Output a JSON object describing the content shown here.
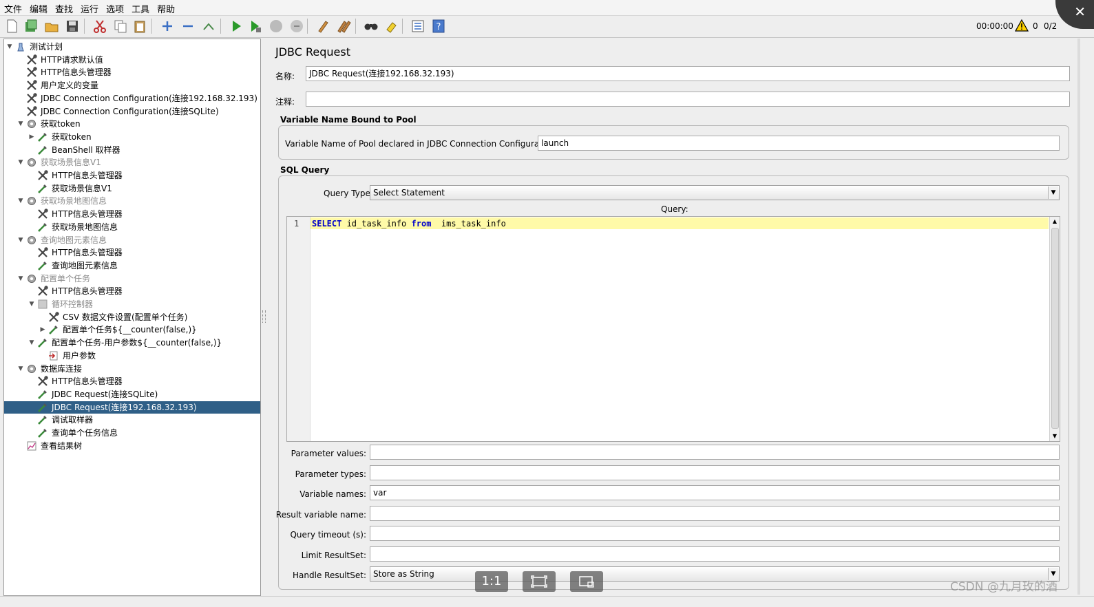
{
  "menu": [
    "文件",
    "编辑",
    "查找",
    "运行",
    "选项",
    "工具",
    "帮助"
  ],
  "toolbar": {
    "icons": [
      "new-icon",
      "templates-icon",
      "open-icon",
      "save-icon",
      "cut-icon",
      "copy-icon",
      "paste-icon",
      "expand-icon",
      "collapse-icon",
      "toggle-icon",
      "start-icon",
      "start-no-pause-icon",
      "stop-icon",
      "shutdown-icon",
      "clear-icon",
      "clear-all-icon",
      "search-icon",
      "reset-search-icon",
      "function-helper-icon",
      "help-icon"
    ],
    "timer": "00:00:00",
    "warning_count": "0",
    "threads": "0/2"
  },
  "tree": [
    {
      "label": "测试计划",
      "icon": "test-plan-icon",
      "toggle": "▼",
      "depth": 0,
      "disabled": false,
      "selected": false
    },
    {
      "label": "HTTP请求默认值",
      "icon": "config-wrench-icon",
      "toggle": "",
      "depth": 1,
      "disabled": false,
      "selected": false
    },
    {
      "label": "HTTP信息头管理器",
      "icon": "config-wrench-icon",
      "toggle": "",
      "depth": 1,
      "disabled": false,
      "selected": false
    },
    {
      "label": "用户定义的变量",
      "icon": "config-wrench-icon",
      "toggle": "",
      "depth": 1,
      "disabled": false,
      "selected": false
    },
    {
      "label": "JDBC Connection Configuration(连接192.168.32.193)",
      "icon": "config-wrench-icon",
      "toggle": "",
      "depth": 1,
      "disabled": false,
      "selected": false
    },
    {
      "label": "JDBC Connection Configuration(连接SQLite)",
      "icon": "config-wrench-icon",
      "toggle": "",
      "depth": 1,
      "disabled": false,
      "selected": false
    },
    {
      "label": "获取token",
      "icon": "thread-group-gear-icon",
      "toggle": "▼",
      "depth": 1,
      "disabled": false,
      "selected": false
    },
    {
      "label": "获取token",
      "icon": "sampler-pipette-icon",
      "toggle": "▶",
      "depth": 2,
      "disabled": false,
      "selected": false
    },
    {
      "label": "BeanShell 取样器",
      "icon": "sampler-pipette-icon",
      "toggle": "",
      "depth": 2,
      "disabled": false,
      "selected": false
    },
    {
      "label": "获取场景信息V1",
      "icon": "thread-group-gear-icon",
      "toggle": "▼",
      "depth": 1,
      "disabled": true,
      "selected": false
    },
    {
      "label": "HTTP信息头管理器",
      "icon": "config-wrench-icon",
      "toggle": "",
      "depth": 2,
      "disabled": false,
      "selected": false
    },
    {
      "label": "获取场景信息V1",
      "icon": "sampler-pipette-icon",
      "toggle": "",
      "depth": 2,
      "disabled": false,
      "selected": false
    },
    {
      "label": "获取场景地图信息",
      "icon": "thread-group-gear-icon",
      "toggle": "▼",
      "depth": 1,
      "disabled": true,
      "selected": false
    },
    {
      "label": "HTTP信息头管理器",
      "icon": "config-wrench-icon",
      "toggle": "",
      "depth": 2,
      "disabled": false,
      "selected": false
    },
    {
      "label": "获取场景地图信息",
      "icon": "sampler-pipette-icon",
      "toggle": "",
      "depth": 2,
      "disabled": false,
      "selected": false
    },
    {
      "label": "查询地图元素信息",
      "icon": "thread-group-gear-icon",
      "toggle": "▼",
      "depth": 1,
      "disabled": true,
      "selected": false
    },
    {
      "label": "HTTP信息头管理器",
      "icon": "config-wrench-icon",
      "toggle": "",
      "depth": 2,
      "disabled": false,
      "selected": false
    },
    {
      "label": "查询地图元素信息",
      "icon": "sampler-pipette-icon",
      "toggle": "",
      "depth": 2,
      "disabled": false,
      "selected": false
    },
    {
      "label": "配置单个任务",
      "icon": "thread-group-gear-icon",
      "toggle": "▼",
      "depth": 1,
      "disabled": true,
      "selected": false
    },
    {
      "label": "HTTP信息头管理器",
      "icon": "config-wrench-icon",
      "toggle": "",
      "depth": 2,
      "disabled": false,
      "selected": false
    },
    {
      "label": "循环控制器",
      "icon": "loop-controller-icon",
      "toggle": "▼",
      "depth": 2,
      "disabled": true,
      "selected": false
    },
    {
      "label": "CSV 数据文件设置(配置单个任务)",
      "icon": "config-wrench-icon",
      "toggle": "",
      "depth": 3,
      "disabled": false,
      "selected": false
    },
    {
      "label": "配置单个任务${__counter(false,)}",
      "icon": "sampler-pipette-icon",
      "toggle": "▶",
      "depth": 3,
      "disabled": false,
      "selected": false
    },
    {
      "label": "配置单个任务-用户参数${__counter(false,)}",
      "icon": "sampler-pipette-icon",
      "toggle": "▼",
      "depth": 2,
      "disabled": false,
      "selected": false
    },
    {
      "label": "用户参数",
      "icon": "preprocessor-icon",
      "toggle": "",
      "depth": 3,
      "disabled": false,
      "selected": false
    },
    {
      "label": "数据库连接",
      "icon": "thread-group-gear-icon",
      "toggle": "▼",
      "depth": 1,
      "disabled": false,
      "selected": false
    },
    {
      "label": "HTTP信息头管理器",
      "icon": "config-wrench-icon",
      "toggle": "",
      "depth": 2,
      "disabled": false,
      "selected": false
    },
    {
      "label": "JDBC Request(连接SQLite)",
      "icon": "sampler-pipette-icon",
      "toggle": "",
      "depth": 2,
      "disabled": false,
      "selected": false
    },
    {
      "label": "JDBC Request(连接192.168.32.193)",
      "icon": "sampler-pipette-icon",
      "toggle": "",
      "depth": 2,
      "disabled": false,
      "selected": true
    },
    {
      "label": "调试取样器",
      "icon": "sampler-pipette-icon",
      "toggle": "",
      "depth": 2,
      "disabled": false,
      "selected": false
    },
    {
      "label": "查询单个任务信息",
      "icon": "sampler-pipette-icon",
      "toggle": "",
      "depth": 2,
      "disabled": false,
      "selected": false
    },
    {
      "label": "查看结果树",
      "icon": "listener-chart-icon",
      "toggle": "",
      "depth": 1,
      "disabled": false,
      "selected": false
    }
  ],
  "panel": {
    "title": "JDBC Request",
    "name_label": "名称:",
    "name_value": "JDBC Request(连接192.168.32.193)",
    "comment_label": "注释:",
    "comment_value": "",
    "pool_group_title": "Variable Name Bound to Pool",
    "pool_label": "Variable Name of Pool declared in JDBC Connection Configuration:",
    "pool_value": "launch",
    "sql_group_title": "SQL Query",
    "query_type_label": "Query Type:",
    "query_type_value": "Select Statement",
    "query_label": "Query:",
    "query_line_number": "1",
    "query_tokens": [
      {
        "text": "SELECT",
        "kw": true
      },
      {
        "text": " id_task_info ",
        "kw": false
      },
      {
        "text": "from",
        "kw": true
      },
      {
        "text": "  ims_task_info",
        "kw": false
      }
    ],
    "fields": [
      {
        "label": "Parameter values:",
        "value": "",
        "type": "input"
      },
      {
        "label": "Parameter types:",
        "value": "",
        "type": "input"
      },
      {
        "label": "Variable names:",
        "value": "var",
        "type": "input"
      },
      {
        "label": "Result variable name:",
        "value": "",
        "type": "input"
      },
      {
        "label": "Query timeout (s):",
        "value": "",
        "type": "input"
      },
      {
        "label": "Limit ResultSet:",
        "value": "",
        "type": "input"
      },
      {
        "label": "Handle ResultSet:",
        "value": "Store as String",
        "type": "select"
      }
    ]
  },
  "overlay_buttons": [
    "1:1",
    "fit-screen-icon",
    "window-icon"
  ],
  "watermark": "CSDN @九月玫的酒",
  "colors": {
    "selection": "#2f5f87",
    "editor_current_line": "#fffaa8",
    "keyword": "#0000cc"
  }
}
